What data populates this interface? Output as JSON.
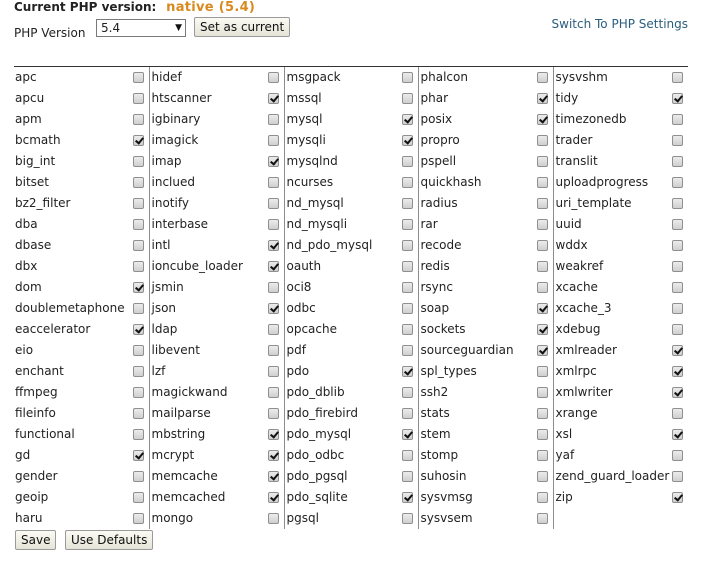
{
  "header": {
    "current_label": "Current PHP version:",
    "current_value": "native (5.4)",
    "version_label": "PHP Version",
    "version_selected": "5.4",
    "set_current_button": "Set as current",
    "switch_link": "Switch To PHP Settings"
  },
  "footer": {
    "save_button": "Save",
    "defaults_button": "Use Defaults"
  },
  "columns": [
    [
      {
        "name": "apc",
        "checked": false
      },
      {
        "name": "apcu",
        "checked": false
      },
      {
        "name": "apm",
        "checked": false
      },
      {
        "name": "bcmath",
        "checked": true
      },
      {
        "name": "big_int",
        "checked": false
      },
      {
        "name": "bitset",
        "checked": false
      },
      {
        "name": "bz2_filter",
        "checked": false
      },
      {
        "name": "dba",
        "checked": false
      },
      {
        "name": "dbase",
        "checked": false
      },
      {
        "name": "dbx",
        "checked": false
      },
      {
        "name": "dom",
        "checked": true
      },
      {
        "name": "doublemetaphone",
        "checked": false
      },
      {
        "name": "eaccelerator",
        "checked": true
      },
      {
        "name": "eio",
        "checked": false
      },
      {
        "name": "enchant",
        "checked": false
      },
      {
        "name": "ffmpeg",
        "checked": false
      },
      {
        "name": "fileinfo",
        "checked": false
      },
      {
        "name": "functional",
        "checked": false
      },
      {
        "name": "gd",
        "checked": true
      },
      {
        "name": "gender",
        "checked": false
      },
      {
        "name": "geoip",
        "checked": false
      },
      {
        "name": "haru",
        "checked": false
      }
    ],
    [
      {
        "name": "hidef",
        "checked": false
      },
      {
        "name": "htscanner",
        "checked": true
      },
      {
        "name": "igbinary",
        "checked": false
      },
      {
        "name": "imagick",
        "checked": false
      },
      {
        "name": "imap",
        "checked": true
      },
      {
        "name": "inclued",
        "checked": false
      },
      {
        "name": "inotify",
        "checked": false
      },
      {
        "name": "interbase",
        "checked": false
      },
      {
        "name": "intl",
        "checked": true
      },
      {
        "name": "ioncube_loader",
        "checked": true
      },
      {
        "name": "jsmin",
        "checked": false
      },
      {
        "name": "json",
        "checked": true
      },
      {
        "name": "ldap",
        "checked": false
      },
      {
        "name": "libevent",
        "checked": false
      },
      {
        "name": "lzf",
        "checked": false
      },
      {
        "name": "magickwand",
        "checked": false
      },
      {
        "name": "mailparse",
        "checked": false
      },
      {
        "name": "mbstring",
        "checked": true
      },
      {
        "name": "mcrypt",
        "checked": true
      },
      {
        "name": "memcache",
        "checked": true
      },
      {
        "name": "memcached",
        "checked": true
      },
      {
        "name": "mongo",
        "checked": false
      }
    ],
    [
      {
        "name": "msgpack",
        "checked": false
      },
      {
        "name": "mssql",
        "checked": false
      },
      {
        "name": "mysql",
        "checked": true
      },
      {
        "name": "mysqli",
        "checked": true
      },
      {
        "name": "mysqlnd",
        "checked": false
      },
      {
        "name": "ncurses",
        "checked": false
      },
      {
        "name": "nd_mysql",
        "checked": false
      },
      {
        "name": "nd_mysqli",
        "checked": false
      },
      {
        "name": "nd_pdo_mysql",
        "checked": false
      },
      {
        "name": "oauth",
        "checked": false
      },
      {
        "name": "oci8",
        "checked": false
      },
      {
        "name": "odbc",
        "checked": false
      },
      {
        "name": "opcache",
        "checked": false
      },
      {
        "name": "pdf",
        "checked": false
      },
      {
        "name": "pdo",
        "checked": true
      },
      {
        "name": "pdo_dblib",
        "checked": false
      },
      {
        "name": "pdo_firebird",
        "checked": false
      },
      {
        "name": "pdo_mysql",
        "checked": true
      },
      {
        "name": "pdo_odbc",
        "checked": false
      },
      {
        "name": "pdo_pgsql",
        "checked": false
      },
      {
        "name": "pdo_sqlite",
        "checked": true
      },
      {
        "name": "pgsql",
        "checked": false
      }
    ],
    [
      {
        "name": "phalcon",
        "checked": false
      },
      {
        "name": "phar",
        "checked": true
      },
      {
        "name": "posix",
        "checked": true
      },
      {
        "name": "propro",
        "checked": false
      },
      {
        "name": "pspell",
        "checked": false
      },
      {
        "name": "quickhash",
        "checked": false
      },
      {
        "name": "radius",
        "checked": false
      },
      {
        "name": "rar",
        "checked": false
      },
      {
        "name": "recode",
        "checked": false
      },
      {
        "name": "redis",
        "checked": false
      },
      {
        "name": "rsync",
        "checked": false
      },
      {
        "name": "soap",
        "checked": true
      },
      {
        "name": "sockets",
        "checked": true
      },
      {
        "name": "sourceguardian",
        "checked": true
      },
      {
        "name": "spl_types",
        "checked": false
      },
      {
        "name": "ssh2",
        "checked": false
      },
      {
        "name": "stats",
        "checked": false
      },
      {
        "name": "stem",
        "checked": false
      },
      {
        "name": "stomp",
        "checked": false
      },
      {
        "name": "suhosin",
        "checked": false
      },
      {
        "name": "sysvmsg",
        "checked": false
      },
      {
        "name": "sysvsem",
        "checked": false
      }
    ],
    [
      {
        "name": "sysvshm",
        "checked": false
      },
      {
        "name": "tidy",
        "checked": true
      },
      {
        "name": "timezonedb",
        "checked": false
      },
      {
        "name": "trader",
        "checked": false
      },
      {
        "name": "translit",
        "checked": false
      },
      {
        "name": "uploadprogress",
        "checked": false
      },
      {
        "name": "uri_template",
        "checked": false
      },
      {
        "name": "uuid",
        "checked": false
      },
      {
        "name": "wddx",
        "checked": false
      },
      {
        "name": "weakref",
        "checked": false
      },
      {
        "name": "xcache",
        "checked": false
      },
      {
        "name": "xcache_3",
        "checked": false
      },
      {
        "name": "xdebug",
        "checked": false
      },
      {
        "name": "xmlreader",
        "checked": true
      },
      {
        "name": "xmlrpc",
        "checked": true
      },
      {
        "name": "xmlwriter",
        "checked": true
      },
      {
        "name": "xrange",
        "checked": false
      },
      {
        "name": "xsl",
        "checked": true
      },
      {
        "name": "yaf",
        "checked": false
      },
      {
        "name": "zend_guard_loader",
        "checked": false
      },
      {
        "name": "zip",
        "checked": true
      }
    ]
  ]
}
